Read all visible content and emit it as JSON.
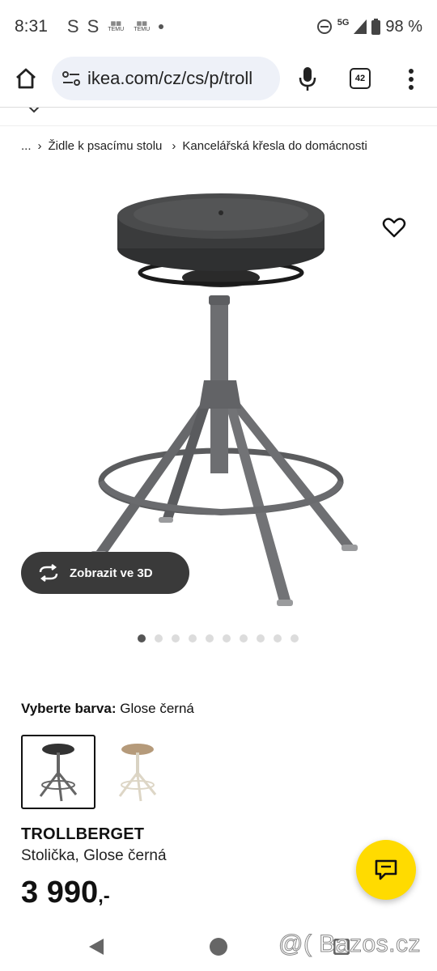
{
  "status_bar": {
    "time": "8:31",
    "notif_s1": "S",
    "notif_s2": "S",
    "temu_label": "TEMU",
    "network": "5G",
    "battery": "98 %"
  },
  "browser": {
    "url": "ikea.com/cz/cs/p/troll",
    "tab_count": "42"
  },
  "breadcrumb": {
    "ellipsis": "...",
    "items": [
      "Židle k psacímu stolu",
      "Kancelářská křesla do domácnosti"
    ]
  },
  "gallery": {
    "view_3d_label": "Zobrazit ve 3D",
    "image_count": 10,
    "active_index": 0
  },
  "color_selector": {
    "label": "Vyberte barva:",
    "selected_value": "Glose černá"
  },
  "product": {
    "name": "TROLLBERGET",
    "description": "Stolička, Glose černá",
    "price_main": "3 990",
    "price_suffix": ",-"
  },
  "watermark": "@( Bazos.cz",
  "colors": {
    "accent_yellow": "#ffdb00",
    "button_dark": "#3a3a3a",
    "url_bg": "#eef1f8"
  },
  "icons": [
    "home-icon",
    "site-settings-icon",
    "mic-icon",
    "tabs-icon",
    "more-vert-icon",
    "heart-icon",
    "rotate-3d-icon",
    "chat-icon",
    "back-icon",
    "home-circle-icon",
    "recents-icon"
  ]
}
